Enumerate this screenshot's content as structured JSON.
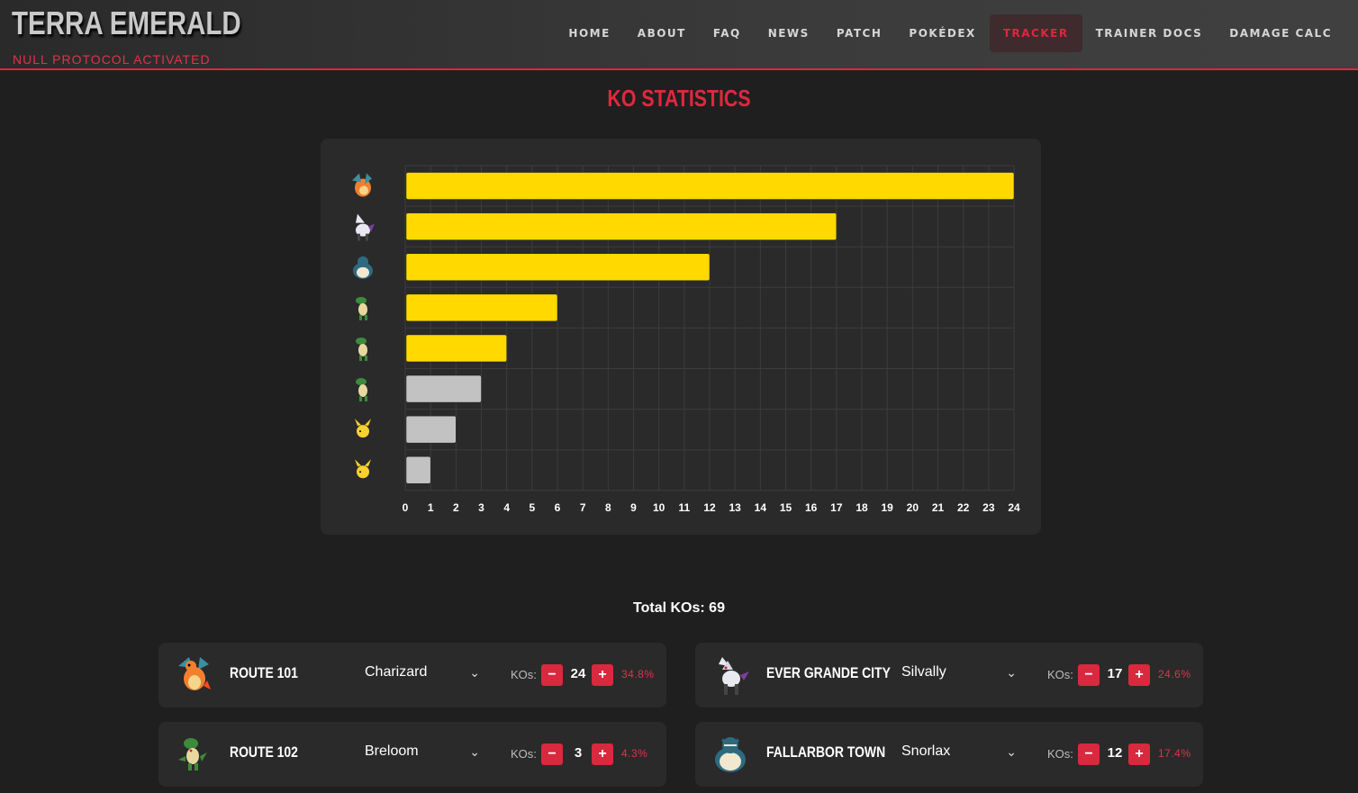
{
  "header": {
    "title": "TERRA EMERALD",
    "subtitle": "NULL PROTOCOL ACTIVATED",
    "nav": [
      "HOME",
      "ABOUT",
      "FAQ",
      "NEWS",
      "PATCH",
      "POKÉDEX",
      "TRACKER",
      "TRAINER DOCS",
      "DAMAGE CALC"
    ],
    "active_nav": "TRACKER"
  },
  "section_title": "KO STATISTICS",
  "chart_data": {
    "type": "bar",
    "orientation": "horizontal",
    "categories": [
      "charizard-icon",
      "silvally-icon",
      "snorlax-icon",
      "breloom-icon",
      "breloom-icon",
      "breloom-icon",
      "pikachu-icon",
      "pikachu-icon"
    ],
    "values": [
      24,
      17,
      12,
      6,
      4,
      3,
      2,
      1
    ],
    "bar_colors": [
      "#ffd900",
      "#ffd900",
      "#ffd900",
      "#ffd900",
      "#ffd900",
      "#c2c2c2",
      "#c2c2c2",
      "#c2c2c2"
    ],
    "xlim": [
      0,
      24
    ],
    "xticks": [
      "0",
      "1",
      "2",
      "3",
      "4",
      "5",
      "6",
      "7",
      "8",
      "9",
      "10",
      "11",
      "12",
      "13",
      "14",
      "15",
      "16",
      "17",
      "18",
      "19",
      "20",
      "21",
      "22",
      "23",
      "24"
    ],
    "grid": true
  },
  "total_kos": "Total KOs: 69",
  "cards": [
    {
      "route": "ROUTE 101",
      "pokemon": "Charizard",
      "icon": "charizard-icon",
      "kos_label": "KOs:",
      "minus": "−",
      "count": "24",
      "plus": "+",
      "pct": "34.8%"
    },
    {
      "route": "EVER GRANDE CITY",
      "pokemon": "Silvally",
      "icon": "silvally-icon",
      "kos_label": "KOs:",
      "minus": "−",
      "count": "17",
      "plus": "+",
      "pct": "24.6%"
    },
    {
      "route": "ROUTE 102",
      "pokemon": "Breloom",
      "icon": "breloom-icon",
      "kos_label": "KOs:",
      "minus": "−",
      "count": "3",
      "plus": "+",
      "pct": "4.3%"
    },
    {
      "route": "FALLARBOR TOWN",
      "pokemon": "Snorlax",
      "icon": "snorlax-icon",
      "kos_label": "KOs:",
      "minus": "−",
      "count": "12",
      "plus": "+",
      "pct": "17.4%"
    }
  ],
  "colors": {
    "accent": "#d9293e",
    "bar_active": "#ffd900",
    "bar_inactive": "#c2c2c2"
  }
}
